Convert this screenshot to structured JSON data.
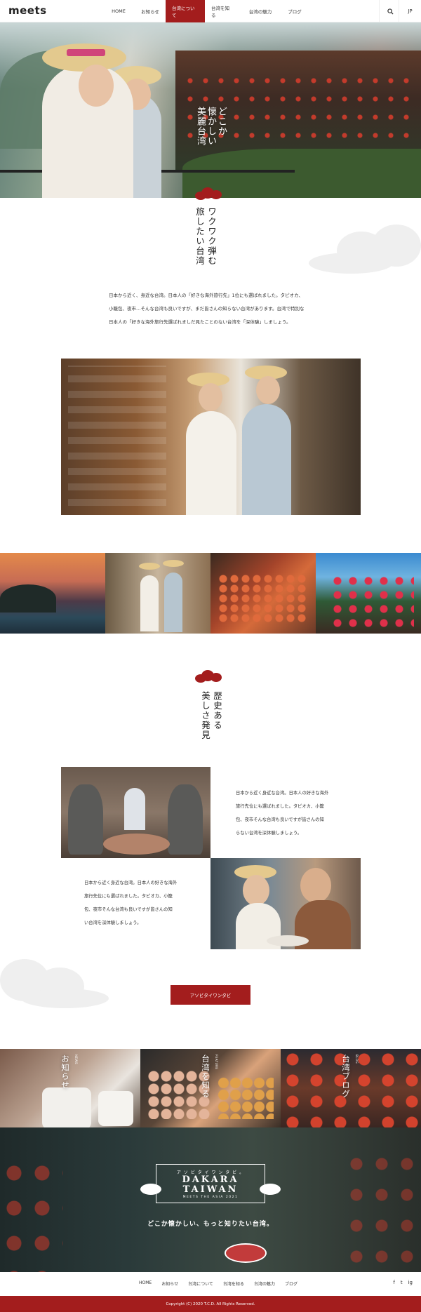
{
  "header": {
    "logo": "meets",
    "nav": [
      "HOME",
      "お知らせ",
      "台湾について",
      "台湾を知る",
      "台湾の魅力",
      "ブログ"
    ],
    "active_index": 2,
    "search_icon": "search-icon",
    "lang_label": "JP"
  },
  "hero": {
    "tagline_lines": [
      "どこか",
      "懐かしい",
      "美麗台湾"
    ]
  },
  "section1": {
    "title_lines": [
      "ワクワク弾む",
      "旅したい台湾"
    ],
    "body": [
      "日本から近く、身近な台湾。日本人の「好きな海外旅行先」1位にも選ばれました。タピオカ、",
      "小籠包、夜市…そんな台湾も良いですが、まだ皆さんの知らない台湾があります。台湾で特別な",
      "日本人の「好きな海外旅行先選ばれましだ見たことのない台湾を「深体験」しましょう。"
    ]
  },
  "section2": {
    "title_lines": [
      "歴史ある",
      "美しさ発見"
    ],
    "body_right": [
      "日本から近く身近な台湾。日本人の好きな海外",
      "旅行先位にも選ばれました。タピオカ、小籠",
      "包、夜市そんな台湾も良いですが皆さんの知",
      "らない台湾を深体験しましょう。"
    ],
    "body_left": [
      "日本から近く身近な台湾。日本人の好きな海外",
      "旅行先位にも選ばれました。タピオカ、小籠",
      "包、夜市そんな台湾も良いですが皆さんの知",
      "い台湾を深体験しましょう。"
    ],
    "button_label": "アソビタイワンタビ"
  },
  "panels": [
    {
      "eyebrow": "NEWS",
      "title": "お知らせ"
    },
    {
      "eyebrow": "FEATURE",
      "title": "台湾を知る"
    },
    {
      "eyebrow": "BLOG",
      "title": "台湾ブログ"
    }
  ],
  "banner": {
    "sub": "ア ソ ビ タ イ ワ ン タ ビ 。",
    "title_line1": "DAKARA",
    "title_line2": "TAIWAN",
    "tiny": "MEETS THE ASIA 2021",
    "tagline": "どこか懐かしい、もっと知りたい台湾。"
  },
  "footer": {
    "links": [
      "HOME",
      "お知らせ",
      "台湾について",
      "台湾を知る",
      "台湾の魅力",
      "ブログ"
    ],
    "social": [
      "f",
      "t",
      "ig"
    ],
    "copyright": "Copyright (C) 2020 T.C.D.  All Rights Reserved."
  }
}
